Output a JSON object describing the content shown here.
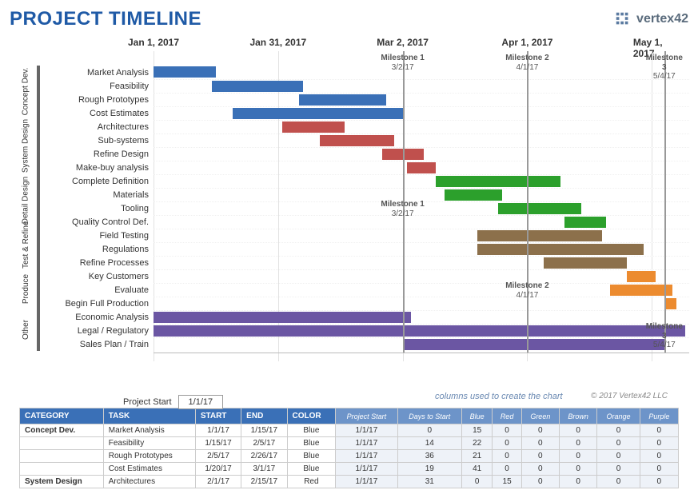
{
  "title": "PROJECT TIMELINE",
  "logo": "vertex42",
  "copyright": "© 2017 Vertex42 LLC",
  "project_start_label": "Project Start",
  "project_start_value": "1/1/17",
  "columns_note": "columns used to create the chart",
  "chart_data": {
    "type": "bar",
    "orientation": "horizontal-gantt",
    "x_start": "2017-01-01",
    "x_end": "2017-05-10",
    "x_ticks": [
      "Jan 1, 2017",
      "Jan 31, 2017",
      "Mar 2, 2017",
      "Apr 1, 2017",
      "May 1, 2017"
    ],
    "milestones": [
      {
        "name": "Milestone 1",
        "date": "3/2/17",
        "label_row": 0
      },
      {
        "name": "Milestone 2",
        "date": "4/1/17",
        "label_row": 0
      },
      {
        "name": "Milestone 3",
        "date": "5/4/17",
        "label_row": 0
      },
      {
        "name": "Milestone 1",
        "date": "3/2/17",
        "label_row": 10
      },
      {
        "name": "Milestone 2",
        "date": "4/1/17",
        "label_row": 16
      },
      {
        "name": "Milestone 3",
        "date": "5/4/17",
        "label_row": 19
      }
    ],
    "groups": [
      {
        "name": "Concept Dev.",
        "rows": [
          0,
          3
        ]
      },
      {
        "name": "System Design",
        "rows": [
          4,
          7
        ]
      },
      {
        "name": "Detail Design",
        "rows": [
          8,
          11
        ]
      },
      {
        "name": "Test & Refine",
        "rows": [
          12,
          14
        ]
      },
      {
        "name": "Produce",
        "rows": [
          15,
          17
        ]
      },
      {
        "name": "Other",
        "rows": [
          18,
          20
        ]
      }
    ],
    "series": [
      {
        "label": "Market Analysis",
        "start": "1/1/17",
        "days": 15,
        "color": "blue"
      },
      {
        "label": "Feasibility",
        "start": "1/15/17",
        "days": 22,
        "color": "blue"
      },
      {
        "label": "Rough Prototypes",
        "start": "2/5/17",
        "days": 21,
        "color": "blue"
      },
      {
        "label": "Cost Estimates",
        "start": "1/20/17",
        "days": 41,
        "color": "blue"
      },
      {
        "label": "Architectures",
        "start": "2/1/17",
        "days": 15,
        "color": "red"
      },
      {
        "label": "Sub-systems",
        "start": "2/10/17",
        "days": 18,
        "color": "red"
      },
      {
        "label": "Refine Design",
        "start": "2/25/17",
        "days": 10,
        "color": "red"
      },
      {
        "label": "Make-buy analysis",
        "start": "3/3/17",
        "days": 7,
        "color": "red"
      },
      {
        "label": "Complete Definition",
        "start": "3/10/17",
        "days": 30,
        "color": "green"
      },
      {
        "label": "Materials",
        "start": "3/12/17",
        "days": 14,
        "color": "green"
      },
      {
        "label": "Tooling",
        "start": "3/25/17",
        "days": 20,
        "color": "green"
      },
      {
        "label": "Quality Control Def.",
        "start": "4/10/17",
        "days": 10,
        "color": "green"
      },
      {
        "label": "Field Testing",
        "start": "3/20/17",
        "days": 30,
        "color": "brown"
      },
      {
        "label": "Regulations",
        "start": "3/20/17",
        "days": 40,
        "color": "brown"
      },
      {
        "label": "Refine Processes",
        "start": "4/5/17",
        "days": 20,
        "color": "brown"
      },
      {
        "label": "Key Customers",
        "start": "4/25/17",
        "days": 7,
        "color": "orange"
      },
      {
        "label": "Evaluate",
        "start": "4/21/17",
        "days": 15,
        "color": "orange"
      },
      {
        "label": "Begin Full Production",
        "start": "5/4/17",
        "days": 3,
        "color": "orange"
      },
      {
        "label": "Economic Analysis",
        "start": "1/1/17",
        "days": 62,
        "color": "purple"
      },
      {
        "label": "Legal / Regulatory",
        "start": "1/1/17",
        "days": 128,
        "color": "purple"
      },
      {
        "label": "Sales Plan / Train",
        "start": "3/2/17",
        "days": 63,
        "color": "purple"
      }
    ]
  },
  "table": {
    "headers_main": [
      "CATEGORY",
      "TASK",
      "START",
      "END",
      "COLOR"
    ],
    "headers_sub": [
      "Project Start",
      "Days to Start",
      "Blue",
      "Red",
      "Green",
      "Brown",
      "Orange",
      "Purple"
    ],
    "rows": [
      {
        "cat": "Concept Dev.",
        "task": "Market Analysis",
        "start": "1/1/17",
        "end": "1/15/17",
        "color": "Blue",
        "ps": "1/1/17",
        "dts": 0,
        "b": 15,
        "r": 0,
        "g": 0,
        "br": 0,
        "o": 0,
        "p": 0
      },
      {
        "cat": "",
        "task": "Feasibility",
        "start": "1/15/17",
        "end": "2/5/17",
        "color": "Blue",
        "ps": "1/1/17",
        "dts": 14,
        "b": 22,
        "r": 0,
        "g": 0,
        "br": 0,
        "o": 0,
        "p": 0
      },
      {
        "cat": "",
        "task": "Rough Prototypes",
        "start": "2/5/17",
        "end": "2/26/17",
        "color": "Blue",
        "ps": "1/1/17",
        "dts": 36,
        "b": 21,
        "r": 0,
        "g": 0,
        "br": 0,
        "o": 0,
        "p": 0
      },
      {
        "cat": "",
        "task": "Cost Estimates",
        "start": "1/20/17",
        "end": "3/1/17",
        "color": "Blue",
        "ps": "1/1/17",
        "dts": 19,
        "b": 41,
        "r": 0,
        "g": 0,
        "br": 0,
        "o": 0,
        "p": 0
      },
      {
        "cat": "System Design",
        "task": "Architectures",
        "start": "2/1/17",
        "end": "2/15/17",
        "color": "Red",
        "ps": "1/1/17",
        "dts": 31,
        "b": 0,
        "r": 15,
        "g": 0,
        "br": 0,
        "o": 0,
        "p": 0
      }
    ]
  }
}
